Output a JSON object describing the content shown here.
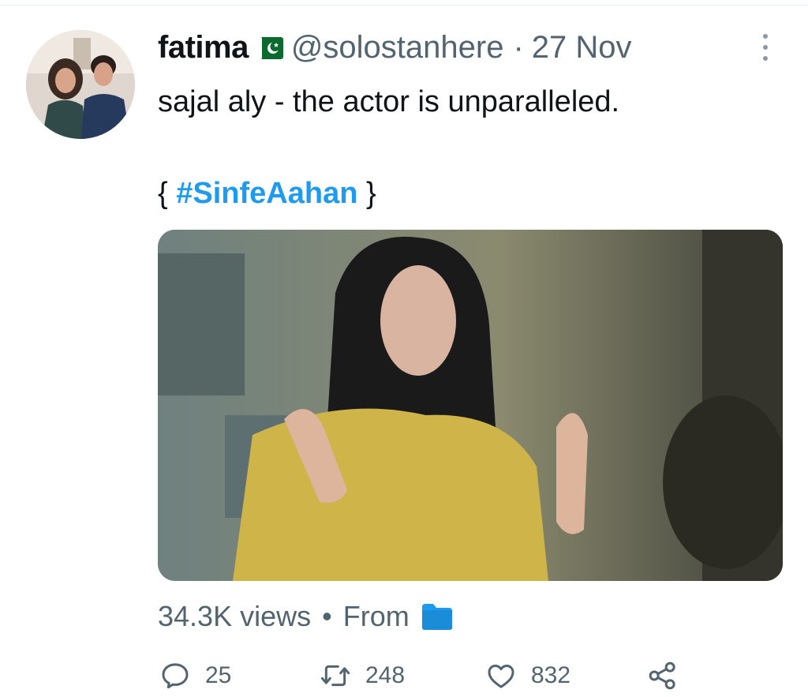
{
  "tweet": {
    "author_name": "fatima",
    "handle": "@solostanhere",
    "separator": "·",
    "date": "27 Nov",
    "text": "sajal aly - the actor is unparalleled.",
    "hashtag_open": "{",
    "hashtag": "#SinfeAahan",
    "hashtag_close": "}"
  },
  "meta": {
    "views": "34.3K views",
    "bullet": "•",
    "from_label": "From"
  },
  "actions": {
    "replies": "25",
    "retweets": "248",
    "likes": "832"
  },
  "colors": {
    "text": "#0f1419",
    "secondary": "#536471",
    "accent": "#1d9bf0"
  },
  "icons": [
    "pakistan-flag-icon",
    "more-icon",
    "folder-icon",
    "reply-icon",
    "retweet-icon",
    "like-icon",
    "share-icon"
  ]
}
